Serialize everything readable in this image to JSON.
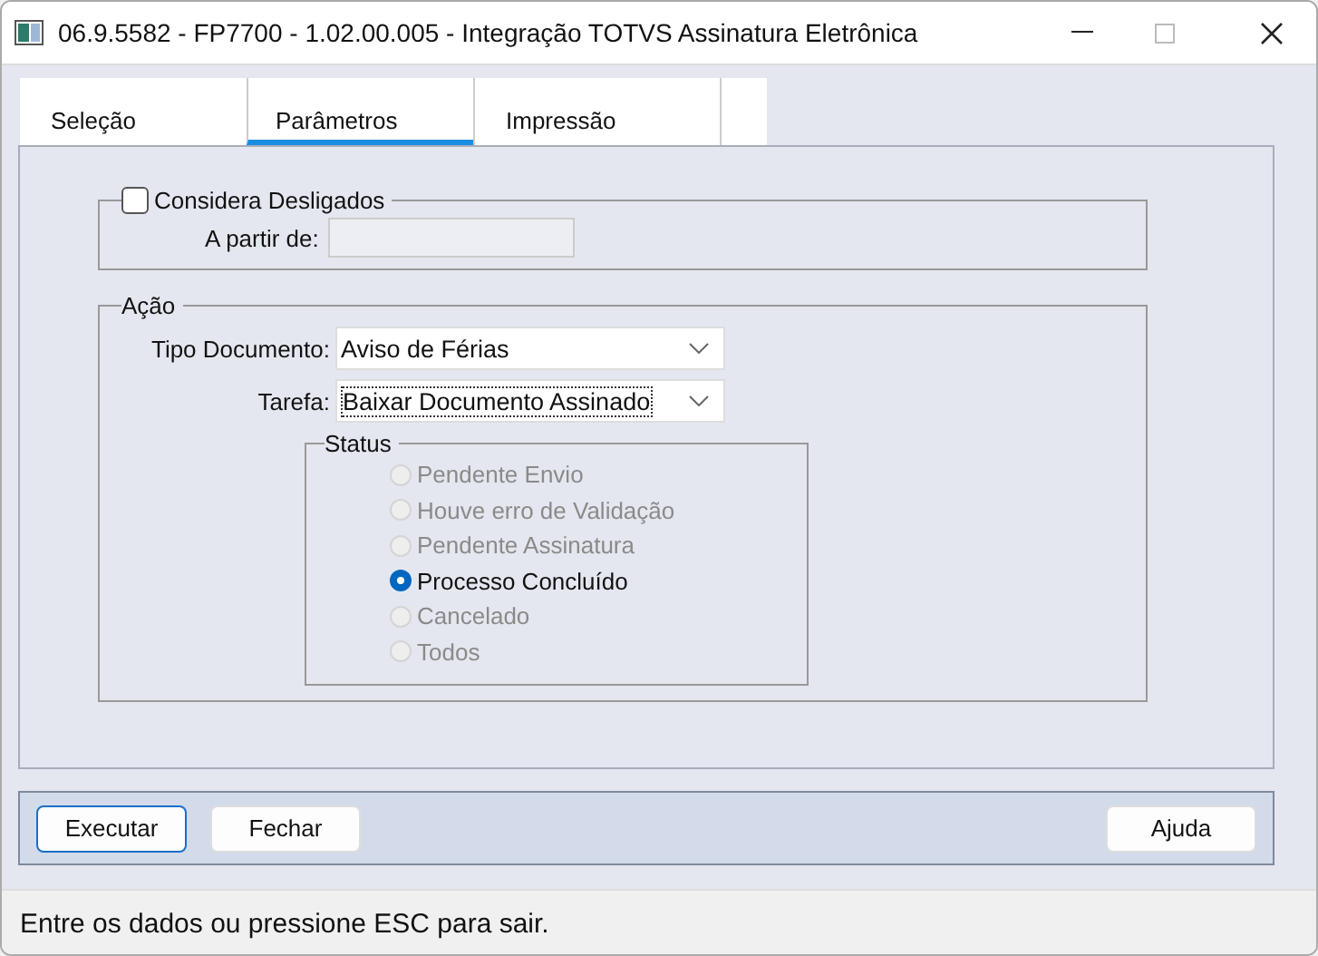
{
  "window": {
    "title": "06.9.5582 - FP7700 - 1.02.00.005 - Integração TOTVS Assinatura Eletrônica"
  },
  "tabs": [
    {
      "label": "Seleção",
      "selected": false
    },
    {
      "label": "Parâmetros",
      "selected": true
    },
    {
      "label": "Impressão",
      "selected": false
    }
  ],
  "desligados": {
    "label": "Considera Desligados",
    "checked": false,
    "date_label": "A partir de:",
    "date_disabled": true
  },
  "acao": {
    "title": "Ação",
    "fields": [
      {
        "label": "Tipo Documento:",
        "value": "Aviso de Férias",
        "focused": false
      },
      {
        "label": "Tarefa:",
        "value": "Baixar Documento Assinado",
        "focused": true
      }
    ],
    "status": {
      "title": "Status",
      "options": [
        {
          "label": "Pendente Envio",
          "selected": false,
          "disabled": true
        },
        {
          "label": "Houve erro de Validação",
          "selected": false,
          "disabled": true
        },
        {
          "label": "Pendente Assinatura",
          "selected": false,
          "disabled": true
        },
        {
          "label": "Processo Concluído",
          "selected": true,
          "disabled": false
        },
        {
          "label": "Cancelado",
          "selected": false,
          "disabled": true
        },
        {
          "label": "Todos",
          "selected": false,
          "disabled": true
        }
      ]
    }
  },
  "buttons": [
    {
      "label": "Executar",
      "default": true
    },
    {
      "label": "Fechar",
      "default": false
    },
    {
      "label": "Ajuda",
      "default": false
    }
  ],
  "status_bar": "Entre os dados ou pressione ESC para sair."
}
